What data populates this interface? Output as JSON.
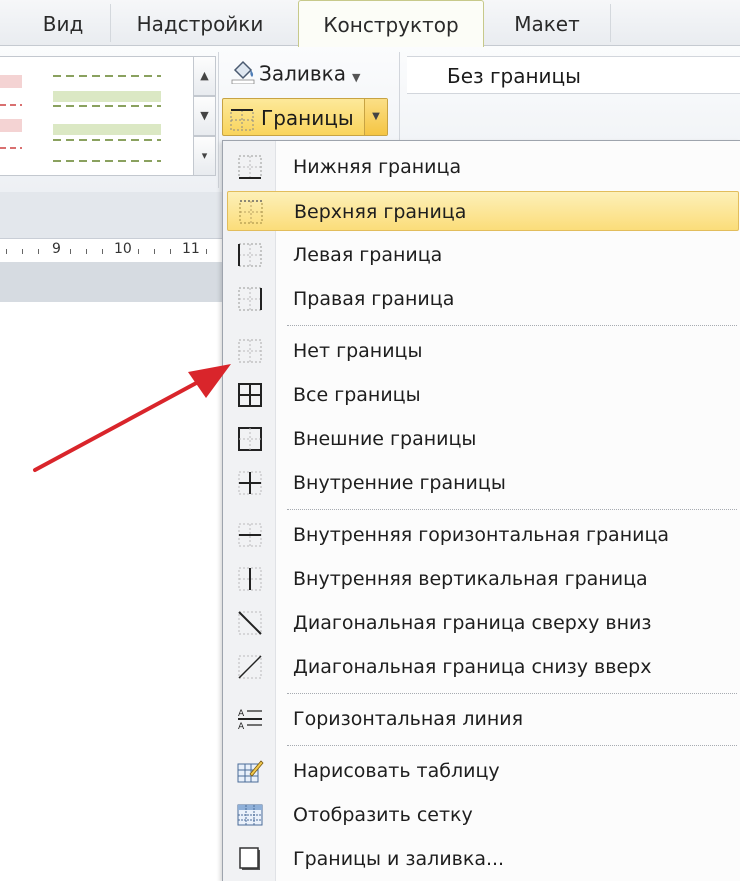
{
  "tabs": [
    {
      "label": "Вид",
      "active": false
    },
    {
      "label": "Надстройки",
      "active": false
    },
    {
      "label": "Конструктор",
      "active": true
    },
    {
      "label": "Макет",
      "active": false
    }
  ],
  "ribbon": {
    "fill_label": "Заливка",
    "borders_label": "Границы",
    "line_style_value": "Без границы"
  },
  "ruler": {
    "labels": [
      "9",
      "10",
      "11"
    ]
  },
  "menu": {
    "items": [
      {
        "label": "Нижняя граница",
        "icon": "border-bottom-icon"
      },
      {
        "label": "Верхняя граница",
        "icon": "border-top-icon",
        "highlighted": true
      },
      {
        "label": "Левая граница",
        "icon": "border-left-icon"
      },
      {
        "label": "Правая граница",
        "icon": "border-right-icon"
      },
      {
        "label": "Нет границы",
        "icon": "border-none-icon"
      },
      {
        "label": "Все границы",
        "icon": "border-all-icon"
      },
      {
        "label": "Внешние границы",
        "icon": "border-outside-icon"
      },
      {
        "label": "Внутренние границы",
        "icon": "border-inside-icon"
      },
      {
        "label": "Внутренняя горизонтальная граница",
        "icon": "border-inside-horizontal-icon"
      },
      {
        "label": "Внутренняя вертикальная граница",
        "icon": "border-inside-vertical-icon"
      },
      {
        "label": "Диагональная граница сверху вниз",
        "icon": "border-diagonal-down-icon"
      },
      {
        "label": "Диагональная граница снизу вверх",
        "icon": "border-diagonal-up-icon"
      },
      {
        "label": "Горизонтальная линия",
        "icon": "horizontal-line-icon"
      },
      {
        "label": "Нарисовать таблицу",
        "icon": "draw-table-icon"
      },
      {
        "label": "Отобразить сетку",
        "icon": "view-gridlines-icon"
      },
      {
        "label": "Границы и заливка...",
        "icon": "borders-and-shading-icon"
      }
    ]
  },
  "colors": {
    "highlight": "#fbdd7a",
    "arrow": "#d9252b",
    "active_tab_border": "#c7c98a"
  }
}
